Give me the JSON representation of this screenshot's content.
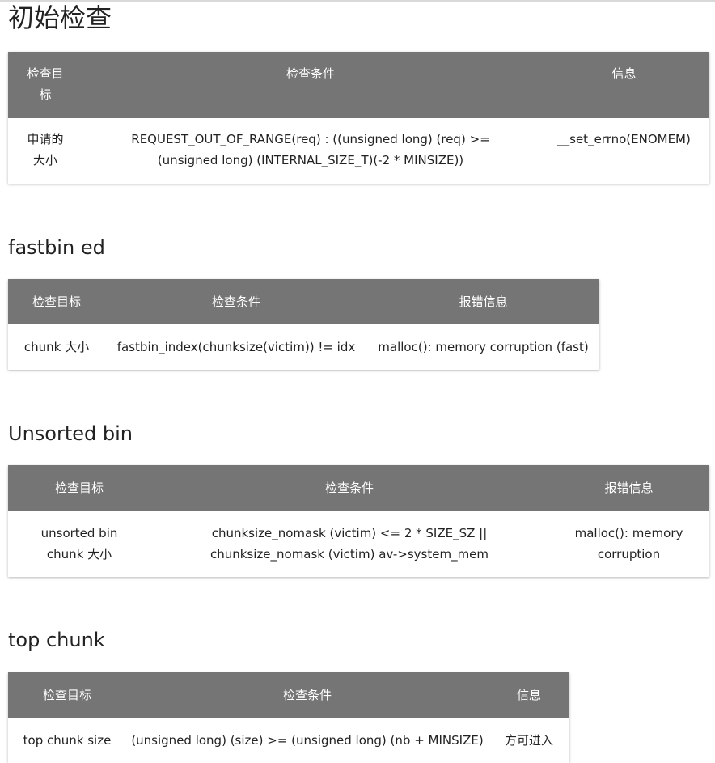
{
  "sections": {
    "initial_check": {
      "title": "初始检查",
      "headers": {
        "target": "检查目标",
        "condition": "检查条件",
        "message": "信息"
      },
      "row": {
        "target": "申请的大小",
        "condition": "REQUEST_OUT_OF_RANGE(req) : ((unsigned long) (req) >= (unsigned long) (INTERNAL_SIZE_T)(-2 * MINSIZE))",
        "message": "__set_errno(ENOMEM)"
      }
    },
    "fastbin": {
      "title": "fastbin ed",
      "headers": {
        "target": "检查目标",
        "condition": "检查条件",
        "message": "报错信息"
      },
      "row": {
        "target": "chunk 大小",
        "condition": "fastbin_index(chunksize(victim)) != idx",
        "message": "malloc(): memory corruption (fast)"
      }
    },
    "unsorted_bin": {
      "title": "Unsorted bin",
      "headers": {
        "target": "检查目标",
        "condition": "检查条件",
        "message": "报错信息"
      },
      "row": {
        "target": "unsorted bin chunk 大小",
        "condition": "chunksize_nomask (victim) <= 2 * SIZE_SZ || chunksize_nomask (victim) av->system_mem",
        "message": "malloc(): memory corruption"
      }
    },
    "top_chunk": {
      "title": "top chunk",
      "headers": {
        "target": "检查目标",
        "condition": "检查条件",
        "message": "信息"
      },
      "row": {
        "target": "top chunk size",
        "condition": "(unsigned long) (size) >= (unsigned long) (nb + MINSIZE)",
        "message": "方可进入"
      }
    }
  },
  "colors": {
    "header_background": "#757575",
    "header_text": "#ffffff",
    "body_text": "#222222",
    "page_background": "#ffffff"
  }
}
